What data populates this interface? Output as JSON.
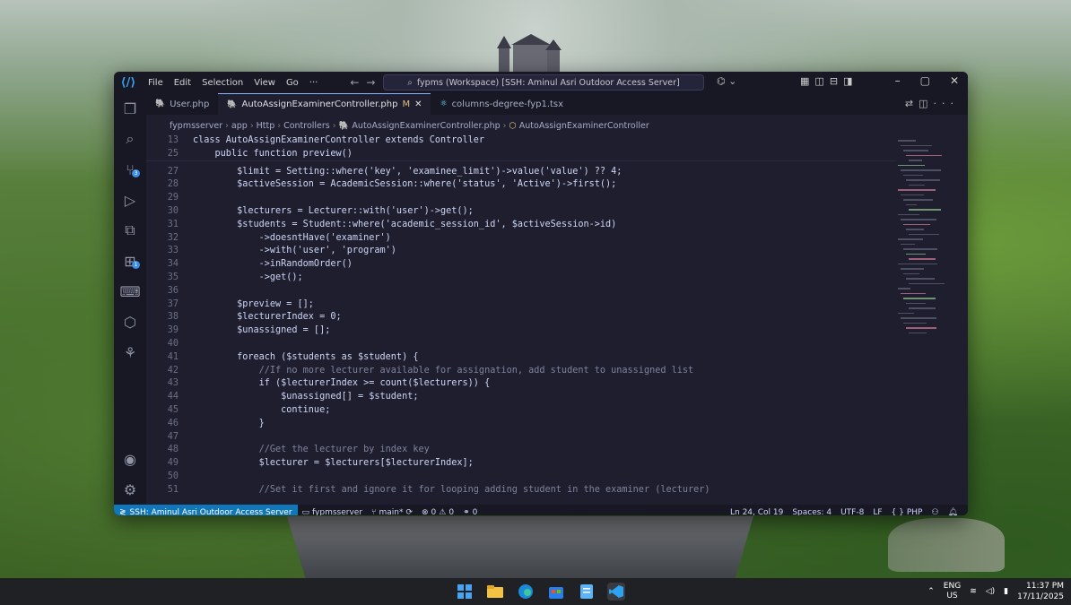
{
  "window": {
    "menu": [
      "File",
      "Edit",
      "Selection",
      "View",
      "Go",
      "···"
    ],
    "search_text": "fypms (Workspace) [SSH: Aminul Asri Outdoor Access Server]"
  },
  "tabs": [
    {
      "label": "User.php",
      "icon": "php-file-icon",
      "active": false,
      "modified": ""
    },
    {
      "label": "AutoAssignExaminerController.php",
      "icon": "php-file-icon",
      "active": true,
      "modified": "M"
    },
    {
      "label": "columns-degree-fyp1.tsx",
      "icon": "react-file-icon",
      "active": false,
      "modified": ""
    }
  ],
  "breadcrumb": [
    "fypmsserver",
    "app",
    "Http",
    "Controllers",
    "AutoAssignExaminerController.php",
    "AutoAssignExaminerController"
  ],
  "code_lines": [
    {
      "n": "13",
      "t": "class AutoAssignExaminerController extends Controller"
    },
    {
      "n": "25",
      "t": "    public function preview()"
    },
    {
      "n": "27",
      "t": "        $limit = Setting::where('key', 'examinee_limit')->value('value') ?? 4;"
    },
    {
      "n": "28",
      "t": "        $activeSession = AcademicSession::where('status', 'Active')->first();"
    },
    {
      "n": "29",
      "t": ""
    },
    {
      "n": "30",
      "t": "        $lecturers = Lecturer::with('user')->get();"
    },
    {
      "n": "31",
      "t": "        $students = Student::where('academic_session_id', $activeSession->id)"
    },
    {
      "n": "32",
      "t": "            ->doesntHave('examiner')"
    },
    {
      "n": "33",
      "t": "            ->with('user', 'program')"
    },
    {
      "n": "34",
      "t": "            ->inRandomOrder()"
    },
    {
      "n": "35",
      "t": "            ->get();"
    },
    {
      "n": "36",
      "t": ""
    },
    {
      "n": "37",
      "t": "        $preview = [];"
    },
    {
      "n": "38",
      "t": "        $lecturerIndex = 0;"
    },
    {
      "n": "39",
      "t": "        $unassigned = [];"
    },
    {
      "n": "40",
      "t": ""
    },
    {
      "n": "41",
      "t": "        foreach ($students as $student) {"
    },
    {
      "n": "42",
      "t": "            //If no more lecturer available for assignation, add student to unassigned list"
    },
    {
      "n": "43",
      "t": "            if ($lecturerIndex >= count($lecturers)) {"
    },
    {
      "n": "44",
      "t": "                $unassigned[] = $student;"
    },
    {
      "n": "45",
      "t": "                continue;"
    },
    {
      "n": "46",
      "t": "            }"
    },
    {
      "n": "47",
      "t": ""
    },
    {
      "n": "48",
      "t": "            //Get the lecturer by index key"
    },
    {
      "n": "49",
      "t": "            $lecturer = $lecturers[$lecturerIndex];"
    },
    {
      "n": "50",
      "t": ""
    },
    {
      "n": "51",
      "t": "            //Set it first and ignore it for looping adding student in the examiner (lecturer)"
    }
  ],
  "statusbar": {
    "remote": "SSH: Aminul Asri Outdoor Access Server",
    "folder": "fypmsserver",
    "branch": "main*",
    "errors": "0",
    "warnings": "0",
    "ports": "0",
    "position": "Ln 24, Col 19",
    "spaces": "Spaces: 4",
    "encoding": "UTF-8",
    "eol": "LF",
    "language": "PHP"
  },
  "taskbar": {
    "lang_line1": "ENG",
    "lang_line2": "US",
    "time": "11:37 PM",
    "date": "17/11/2025"
  },
  "colors": {
    "accent_remote": "#1177bb",
    "editor_bg": "#1e1e2e",
    "taskbar_bg": "#202124"
  }
}
